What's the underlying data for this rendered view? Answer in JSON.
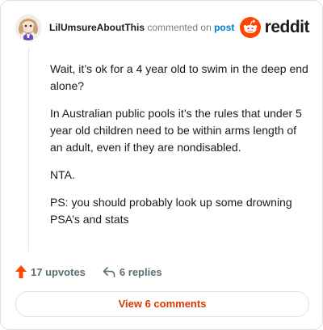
{
  "comment": {
    "author": "LilUmsureAboutThis",
    "commented_text": "commented on",
    "post_link": "post",
    "brand": "reddit",
    "paragraphs": [
      "Wait, it’s ok for a 4 year old to swim in the deep end alone?",
      "In Australian public pools it’s the rules that under 5 year old children need to be within arms length of an adult, even if they are nondisabled.",
      "NTA.",
      "PS: you should probably look up some drowning PSA’s and stats"
    ],
    "upvotes": "17 upvotes",
    "replies": "6 replies",
    "view_button": "View 6 comments"
  },
  "colors": {
    "reddit_orange": "#ff4500",
    "upvote": "#ff4500",
    "link_blue": "#0079d3",
    "button_text": "#d93900"
  },
  "icons": {
    "avatar": "snoo-avatar",
    "brand": "reddit-logo-icon",
    "upvote": "upvote-arrow-icon",
    "reply": "reply-arrow-icon"
  }
}
